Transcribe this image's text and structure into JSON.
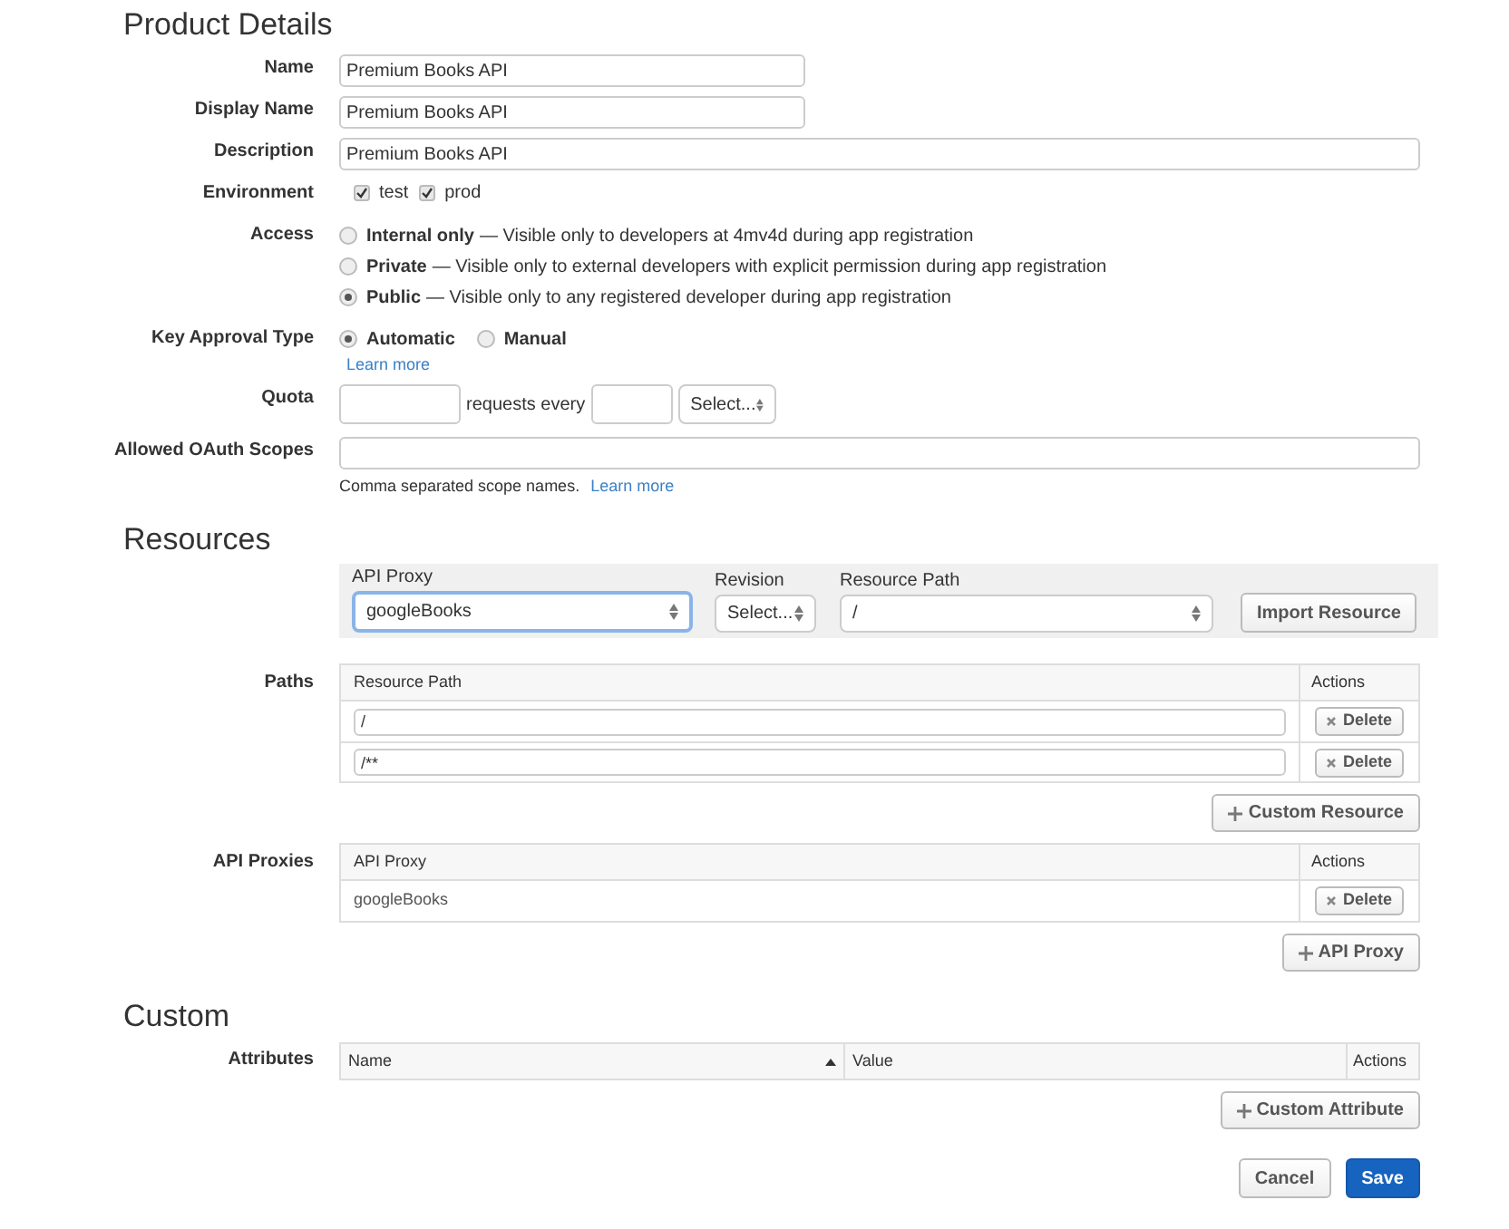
{
  "product_details": {
    "title": "Product Details",
    "name": {
      "label": "Name",
      "value": "Premium Books API"
    },
    "display_name": {
      "label": "Display Name",
      "value": "Premium Books API"
    },
    "description": {
      "label": "Description",
      "value": "Premium Books API"
    },
    "environment": {
      "label": "Environment",
      "options": [
        {
          "label": "test",
          "checked": true
        },
        {
          "label": "prod",
          "checked": true
        }
      ]
    },
    "access": {
      "label": "Access",
      "options": [
        {
          "label": "Internal only",
          "note": "— Visible only to developers at 4mv4d during app registration",
          "selected": false
        },
        {
          "label": "Private",
          "note": "— Visible only to external developers with explicit permission during app registration",
          "selected": false
        },
        {
          "label": "Public",
          "note": "— Visible only to any registered developer during app registration",
          "selected": true
        }
      ]
    },
    "key_approval": {
      "label": "Key Approval Type",
      "options": [
        {
          "label": "Automatic",
          "selected": true
        },
        {
          "label": "Manual",
          "selected": false
        }
      ],
      "link": "Learn more"
    },
    "quota": {
      "label": "Quota",
      "between": "requests every",
      "select": "Select..."
    },
    "oauth_scopes": {
      "label": "Allowed OAuth Scopes",
      "hint": "Comma separated scope names.",
      "link": "Learn more"
    }
  },
  "resources": {
    "title": "Resources",
    "import_bar": {
      "proxy_label": "API Proxy",
      "proxy_value": "googleBooks",
      "revision_label": "Revision",
      "revision_value": "Select...",
      "path_label": "Resource Path",
      "path_value": "/",
      "button": "Import Resource"
    },
    "paths": {
      "label": "Paths",
      "columns": [
        "Resource Path",
        "Actions"
      ],
      "rows": [
        {
          "value": "/",
          "action": "Delete"
        },
        {
          "value": "/**",
          "action": "Delete"
        }
      ],
      "add_button": "Custom Resource"
    },
    "api_proxies": {
      "label": "API Proxies",
      "columns": [
        "API Proxy",
        "Actions"
      ],
      "rows": [
        {
          "value": "googleBooks",
          "action": "Delete"
        }
      ],
      "add_button": "API Proxy"
    }
  },
  "custom": {
    "title": "Custom",
    "attributes": {
      "label": "Attributes",
      "columns": [
        "Name",
        "Value",
        "Actions"
      ],
      "add_button": "Custom Attribute"
    }
  },
  "buttons": [
    {
      "label": "Cancel",
      "kind": "secondary"
    },
    {
      "label": "Save",
      "kind": "primary"
    }
  ]
}
